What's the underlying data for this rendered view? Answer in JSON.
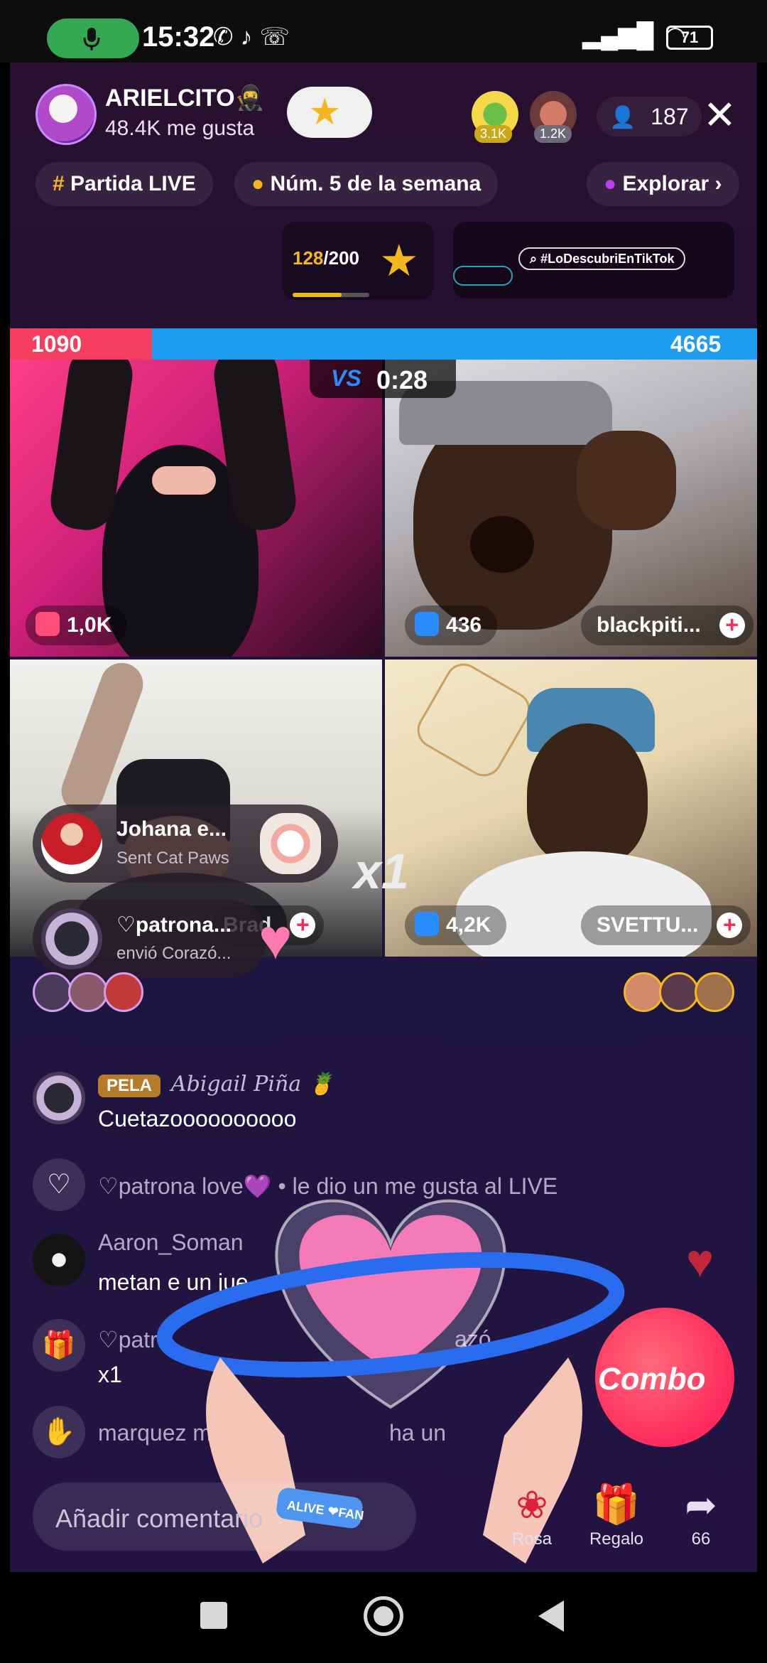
{
  "status_bar": {
    "time": "15:32",
    "battery": "71",
    "icons": [
      "microphone-icon",
      "whatsapp-icon",
      "tiktok-icon",
      "phone-icon",
      "signal-icon",
      "wifi-icon",
      "battery-icon"
    ]
  },
  "host": {
    "name": "ARIELCITO🥷",
    "likes": "48.4K me gusta"
  },
  "top_viewers": [
    {
      "badge": "3.1K"
    },
    {
      "badge": "1.2K"
    }
  ],
  "viewer_count": "187",
  "chips": {
    "match": "Partida LIVE",
    "rank": "Núm. 5 de la semana",
    "explore": "Explorar"
  },
  "goal": {
    "current": "128",
    "total": "/200",
    "progress": 0.64
  },
  "promo_tag": "#LoDescubriEnTikTok",
  "battle": {
    "left_score": "1090",
    "right_score": "4665",
    "vs": "VS",
    "timer": "0:28",
    "left_share": 0.19
  },
  "cells": [
    {
      "stat": "1,0K",
      "name": "",
      "stat_color": "#ff4d7a"
    },
    {
      "stat": "436",
      "name": "blackpiti...",
      "stat_color": "#2a8cff"
    },
    {
      "stat": "",
      "name": "",
      "stat_color": "#2a8cff"
    },
    {
      "stat": "4,2K",
      "name": "SVETTU...",
      "stat_color": "#2a8cff"
    }
  ],
  "gift_notifications": [
    {
      "name": "Johana  e...",
      "sub": "Sent Cat Paws"
    },
    {
      "name": "♡patrona...",
      "sub": "envió Corazó..."
    }
  ],
  "gift_multiplier": "x1",
  "cell3_name_fragment": "Brad",
  "comments": [
    {
      "type": "user",
      "badge": "PELA",
      "script_name": "Abigail Piña 🍍",
      "text": "Cuetazoooooooooo"
    },
    {
      "type": "like",
      "text": "♡patrona love💜 • le dio un me gusta al LIVE"
    },
    {
      "type": "user2",
      "user": "Aaron_Soman",
      "text": "metan e un jue"
    },
    {
      "type": "gift",
      "user": "♡patro",
      "mid": "azó",
      "text": "x1"
    },
    {
      "type": "wave",
      "text": "marquez marq",
      "tail": "ha un"
    }
  ],
  "combo_label": "Combo",
  "comment_placeholder": "Añadir comentario",
  "actions": [
    {
      "label": "Rosa",
      "icon": "rose-icon"
    },
    {
      "label": "Regalo",
      "icon": "gift-icon"
    },
    {
      "label": "66",
      "icon": "share-icon"
    }
  ],
  "heart_bracelet": "ALIVE ❤FAN",
  "colors": {
    "red_team": "#f43d5f",
    "blue_team": "#1e9cf0",
    "accent_gold": "#f3b820",
    "combo": "#ff2a5c"
  }
}
